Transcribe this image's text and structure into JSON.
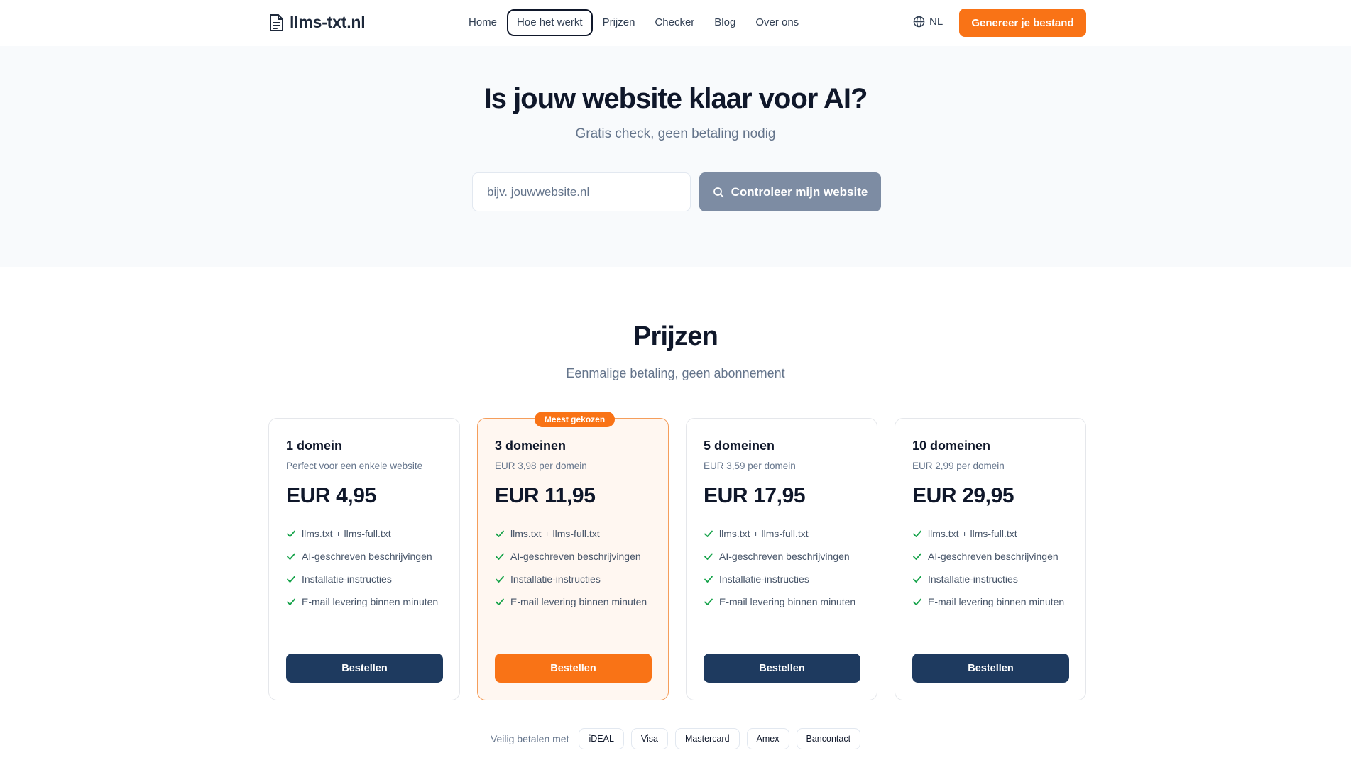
{
  "header": {
    "logo_text": "llms-txt.nl",
    "nav": [
      {
        "label": "Home",
        "active": false
      },
      {
        "label": "Hoe het werkt",
        "active": true
      },
      {
        "label": "Prijzen",
        "active": false
      },
      {
        "label": "Checker",
        "active": false
      },
      {
        "label": "Blog",
        "active": false
      },
      {
        "label": "Over ons",
        "active": false
      }
    ],
    "language": "NL",
    "cta_label": "Genereer je bestand"
  },
  "hero": {
    "title": "Is jouw website klaar voor AI?",
    "subtitle": "Gratis check, geen betaling nodig",
    "search": {
      "placeholder": "bijv. jouwwebsite.nl",
      "value": ""
    },
    "check_button_label": "Controleer mijn website"
  },
  "pricing": {
    "title": "Prijzen",
    "subtitle": "Eenmalige betaling, geen abonnement",
    "plans": [
      {
        "name": "1 domein",
        "description": "Perfect voor een enkele website",
        "price": "EUR 4,95",
        "featured": false,
        "badge": "",
        "features": [
          "llms.txt + llms-full.txt",
          "AI-geschreven beschrijvingen",
          "Installatie-instructies",
          "E-mail levering binnen minuten"
        ],
        "button_label": "Bestellen"
      },
      {
        "name": "3 domeinen",
        "description": "EUR 3,98 per domein",
        "price": "EUR 11,95",
        "featured": true,
        "badge": "Meest gekozen",
        "features": [
          "llms.txt + llms-full.txt",
          "AI-geschreven beschrijvingen",
          "Installatie-instructies",
          "E-mail levering binnen minuten"
        ],
        "button_label": "Bestellen"
      },
      {
        "name": "5 domeinen",
        "description": "EUR 3,59 per domein",
        "price": "EUR 17,95",
        "featured": false,
        "badge": "",
        "features": [
          "llms.txt + llms-full.txt",
          "AI-geschreven beschrijvingen",
          "Installatie-instructies",
          "E-mail levering binnen minuten"
        ],
        "button_label": "Bestellen"
      },
      {
        "name": "10 domeinen",
        "description": "EUR 2,99 per domein",
        "price": "EUR 29,95",
        "featured": false,
        "badge": "",
        "features": [
          "llms.txt + llms-full.txt",
          "AI-geschreven beschrijvingen",
          "Installatie-instructies",
          "E-mail levering binnen minuten"
        ],
        "button_label": "Bestellen"
      }
    ]
  },
  "payments": {
    "label": "Veilig betalen met",
    "methods": [
      "iDEAL",
      "Visa",
      "Mastercard",
      "Amex",
      "Bancontact"
    ]
  },
  "colors": {
    "accent": "#f97316",
    "primary_button": "#1e3a5f",
    "check_button": "#7d8ca3",
    "check_icon": "#16a34a",
    "hero_background": "#f8fafc"
  },
  "icons": {
    "logo": "file-text-icon",
    "language": "globe-icon",
    "search": "search-icon",
    "feature": "check-icon"
  }
}
